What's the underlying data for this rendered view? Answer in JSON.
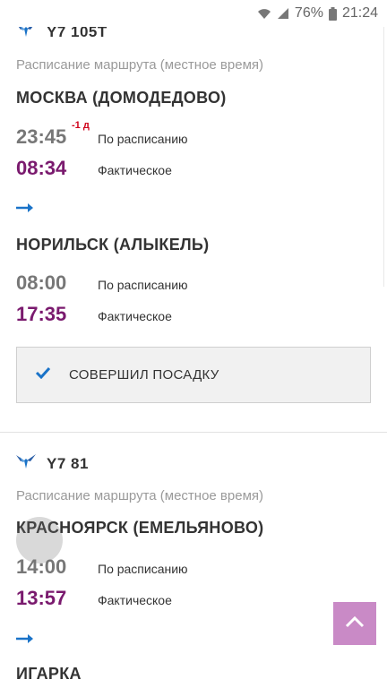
{
  "status_bar": {
    "battery_percent": "76%",
    "time": "21:24"
  },
  "flights": [
    {
      "code": "Y7 105T",
      "caption": "Расписание маршрута (местное время)",
      "origin": {
        "city": "МОСКВА (ДОМОДЕДОВО)",
        "scheduled": "23:45",
        "day_shift": "-1 д",
        "scheduled_label": "По расписанию",
        "actual": "08:34",
        "actual_label": "Фактическое"
      },
      "destination": {
        "city": "НОРИЛЬСК (АЛЫКЕЛЬ)",
        "scheduled": "08:00",
        "scheduled_label": "По расписанию",
        "actual": "17:35",
        "actual_label": "Фактическое"
      },
      "status": "СОВЕРШИЛ ПОСАДКУ"
    },
    {
      "code": "Y7 81",
      "caption": "Расписание маршрута (местное время)",
      "origin": {
        "city": "КРАСНОЯРСК (ЕМЕЛЬЯНОВО)",
        "scheduled": "14:00",
        "scheduled_label": "По расписанию",
        "actual": "13:57",
        "actual_label": "Фактическое"
      },
      "destination": {
        "city": "ИГАРКА"
      }
    }
  ],
  "colors": {
    "actual_time": "#7a1a6e",
    "accent_blue": "#1a73c8",
    "scroll_top_button": "#c98ac6"
  }
}
